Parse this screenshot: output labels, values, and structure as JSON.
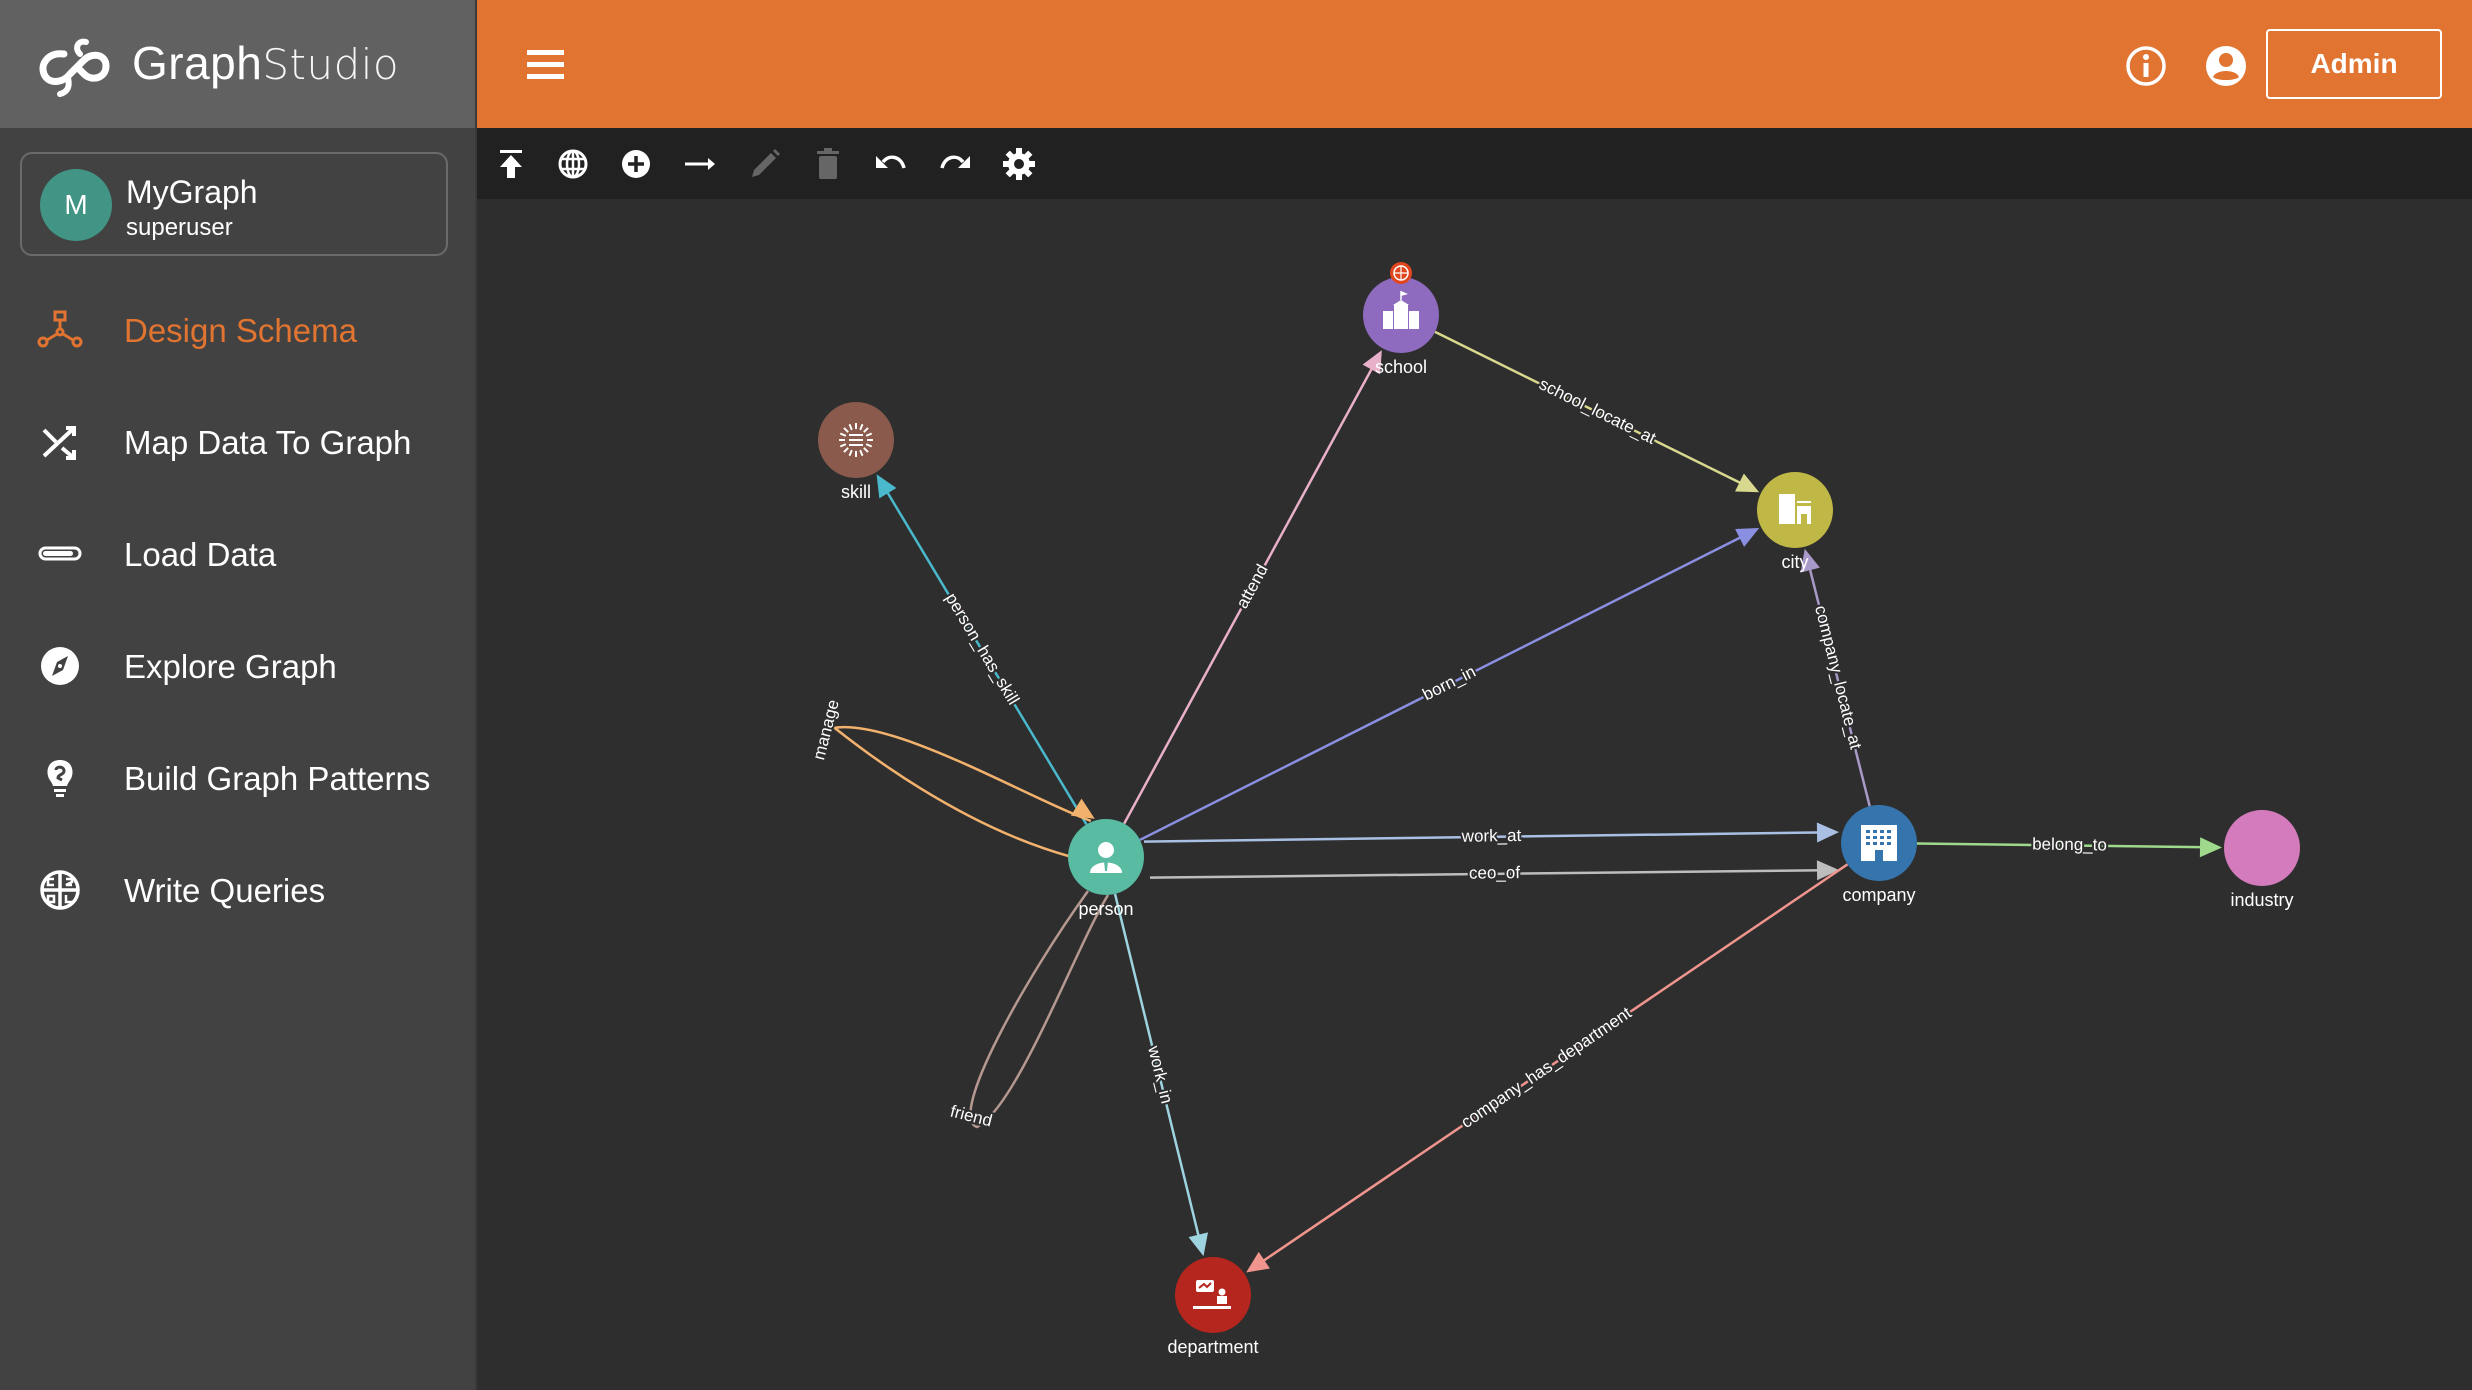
{
  "app": {
    "logo_bold": "Graph",
    "logo_light": "Studio"
  },
  "user_card": {
    "avatar_letter": "M",
    "graph_name": "MyGraph",
    "role": "superuser"
  },
  "sidebar": {
    "items": [
      {
        "label": "Design Schema",
        "icon": "schema-icon",
        "active": true
      },
      {
        "label": "Map Data To Graph",
        "icon": "shuffle-icon",
        "active": false
      },
      {
        "label": "Load Data",
        "icon": "progress-bar-icon",
        "active": false
      },
      {
        "label": "Explore Graph",
        "icon": "compass-icon",
        "active": false
      },
      {
        "label": "Build Graph Patterns",
        "icon": "lightbulb-icon",
        "active": false
      },
      {
        "label": "Write Queries",
        "icon": "gsql-icon",
        "active": false
      }
    ]
  },
  "header": {
    "menu_icon": "hamburger-icon",
    "info_icon": "info-icon",
    "account_icon": "account-circle-icon",
    "admin_label": "Admin"
  },
  "toolbar": {
    "buttons": [
      {
        "name": "publish-schema",
        "icon": "publish-icon",
        "enabled": true
      },
      {
        "name": "global-types",
        "icon": "globe-icon",
        "enabled": true
      },
      {
        "name": "add-vertex",
        "icon": "add-circle-icon",
        "enabled": true
      },
      {
        "name": "add-edge",
        "icon": "arrow-right-icon",
        "enabled": true
      },
      {
        "name": "edit",
        "icon": "pencil-icon",
        "enabled": false
      },
      {
        "name": "delete",
        "icon": "trash-icon",
        "enabled": false
      },
      {
        "name": "undo",
        "icon": "undo-icon",
        "enabled": true
      },
      {
        "name": "redo",
        "icon": "redo-icon",
        "enabled": true
      },
      {
        "name": "settings",
        "icon": "gear-icon",
        "enabled": true
      }
    ]
  },
  "colors": {
    "accent": "#e07430",
    "header_bg": "#e07430",
    "sidebar_bg": "#424242",
    "logo_bg": "#616161",
    "toolbar_bg": "#212121",
    "canvas_bg": "#2e2e2e"
  },
  "graph": {
    "vertices": [
      {
        "id": "school",
        "label": "school",
        "color": "#8e6bbf",
        "icon": "school-icon",
        "global": true
      },
      {
        "id": "skill",
        "label": "skill",
        "color": "#8a5a4c",
        "icon": "skill-icon",
        "global": false
      },
      {
        "id": "city",
        "label": "city",
        "color": "#bfb846",
        "icon": "city-icon",
        "global": false
      },
      {
        "id": "person",
        "label": "person",
        "color": "#58bba2",
        "icon": "person-icon",
        "global": false
      },
      {
        "id": "company",
        "label": "company",
        "color": "#3574ad",
        "icon": "company-icon",
        "global": false
      },
      {
        "id": "industry",
        "label": "industry",
        "color": "#d47bbd",
        "icon": "",
        "global": false
      },
      {
        "id": "department",
        "label": "department",
        "color": "#b5261e",
        "icon": "department-icon",
        "global": false
      }
    ],
    "edges": [
      {
        "label": "school_locate_at",
        "from": "school",
        "to": "city",
        "color": "#d8d88e"
      },
      {
        "label": "attend",
        "from": "person",
        "to": "school",
        "color": "#e9b1c9"
      },
      {
        "label": "born_in",
        "from": "person",
        "to": "city",
        "color": "#8a8fe2"
      },
      {
        "label": "person_has_skill",
        "from": "person",
        "to": "skill",
        "color": "#4ab9cc"
      },
      {
        "label": "manage",
        "from": "person",
        "to": "person",
        "color": "#f2b26d"
      },
      {
        "label": "friend",
        "from": "person",
        "to": "person",
        "color": "#b59890"
      },
      {
        "label": "work_at",
        "from": "person",
        "to": "company",
        "color": "#a9c0e4"
      },
      {
        "label": "ceo_of",
        "from": "person",
        "to": "company",
        "color": "#bdbdbd"
      },
      {
        "label": "company_locate_at",
        "from": "company",
        "to": "city",
        "color": "#a999c8"
      },
      {
        "label": "belong_to",
        "from": "company",
        "to": "industry",
        "color": "#9fd98b"
      },
      {
        "label": "work_in",
        "from": "person",
        "to": "department",
        "color": "#9ed3e0"
      },
      {
        "label": "company_has_department",
        "from": "company",
        "to": "department",
        "color": "#f0958e"
      }
    ]
  }
}
